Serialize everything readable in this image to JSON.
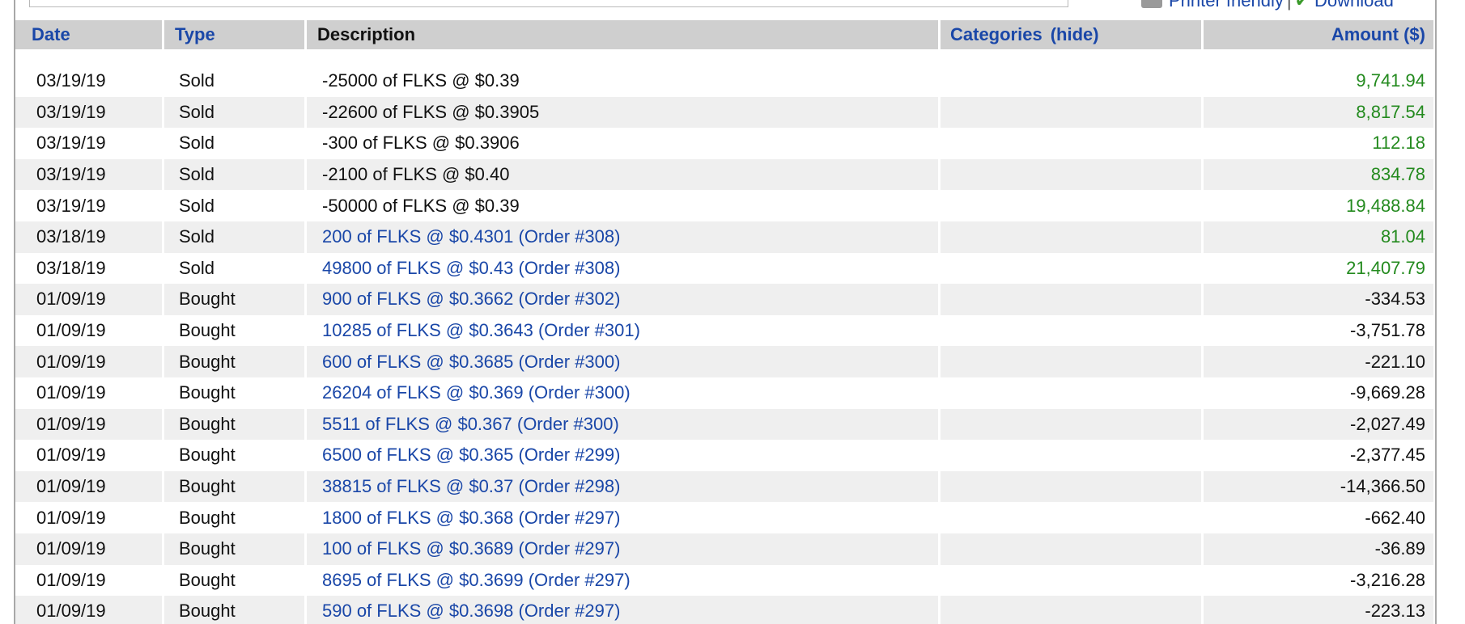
{
  "toolbar": {
    "printer_friendly": "Printer friendly",
    "separator": "|",
    "download": "Download"
  },
  "table": {
    "headers": {
      "date": "Date",
      "type": "Type",
      "description": "Description",
      "categories": "Categories",
      "hide": "(hide)",
      "amount": "Amount ($)"
    },
    "rows": [
      {
        "date": "03/19/19",
        "type": "Sold",
        "description": "-25000 of FLKS @ $0.39",
        "link": false,
        "amount": "9,741.94",
        "positive": true
      },
      {
        "date": "03/19/19",
        "type": "Sold",
        "description": "-22600 of FLKS @ $0.3905",
        "link": false,
        "amount": "8,817.54",
        "positive": true
      },
      {
        "date": "03/19/19",
        "type": "Sold",
        "description": "-300 of FLKS @ $0.3906",
        "link": false,
        "amount": "112.18",
        "positive": true
      },
      {
        "date": "03/19/19",
        "type": "Sold",
        "description": "-2100 of FLKS @ $0.40",
        "link": false,
        "amount": "834.78",
        "positive": true
      },
      {
        "date": "03/19/19",
        "type": "Sold",
        "description": "-50000 of FLKS @ $0.39",
        "link": false,
        "amount": "19,488.84",
        "positive": true
      },
      {
        "date": "03/18/19",
        "type": "Sold",
        "description": "200 of FLKS @ $0.4301 (Order #308)",
        "link": true,
        "amount": "81.04",
        "positive": true
      },
      {
        "date": "03/18/19",
        "type": "Sold",
        "description": "49800 of FLKS @ $0.43 (Order #308)",
        "link": true,
        "amount": "21,407.79",
        "positive": true
      },
      {
        "date": "01/09/19",
        "type": "Bought",
        "description": "900 of FLKS @ $0.3662 (Order #302)",
        "link": true,
        "amount": "-334.53",
        "positive": false
      },
      {
        "date": "01/09/19",
        "type": "Bought",
        "description": "10285 of FLKS @ $0.3643 (Order #301)",
        "link": true,
        "amount": "-3,751.78",
        "positive": false
      },
      {
        "date": "01/09/19",
        "type": "Bought",
        "description": "600 of FLKS @ $0.3685 (Order #300)",
        "link": true,
        "amount": "-221.10",
        "positive": false
      },
      {
        "date": "01/09/19",
        "type": "Bought",
        "description": "26204 of FLKS @ $0.369 (Order #300)",
        "link": true,
        "amount": "-9,669.28",
        "positive": false
      },
      {
        "date": "01/09/19",
        "type": "Bought",
        "description": "5511 of FLKS @ $0.367 (Order #300)",
        "link": true,
        "amount": "-2,027.49",
        "positive": false
      },
      {
        "date": "01/09/19",
        "type": "Bought",
        "description": "6500 of FLKS @ $0.365 (Order #299)",
        "link": true,
        "amount": "-2,377.45",
        "positive": false
      },
      {
        "date": "01/09/19",
        "type": "Bought",
        "description": "38815 of FLKS @ $0.37 (Order #298)",
        "link": true,
        "amount": "-14,366.50",
        "positive": false
      },
      {
        "date": "01/09/19",
        "type": "Bought",
        "description": "1800 of FLKS @ $0.368 (Order #297)",
        "link": true,
        "amount": "-662.40",
        "positive": false
      },
      {
        "date": "01/09/19",
        "type": "Bought",
        "description": "100 of FLKS @ $0.3689 (Order #297)",
        "link": true,
        "amount": "-36.89",
        "positive": false
      },
      {
        "date": "01/09/19",
        "type": "Bought",
        "description": "8695 of FLKS @ $0.3699 (Order #297)",
        "link": true,
        "amount": "-3,216.28",
        "positive": false
      },
      {
        "date": "01/09/19",
        "type": "Bought",
        "description": "590 of FLKS @ $0.3698 (Order #297)",
        "link": true,
        "amount": "-223.13",
        "positive": false
      }
    ]
  },
  "colors": {
    "link": "#1a47a8",
    "positive_amount": "#238a1e",
    "header_bg": "#cfcfcf",
    "row_alt_bg": "#efefef"
  },
  "icons": {
    "printer": "printer-icon",
    "download": "download-icon"
  }
}
